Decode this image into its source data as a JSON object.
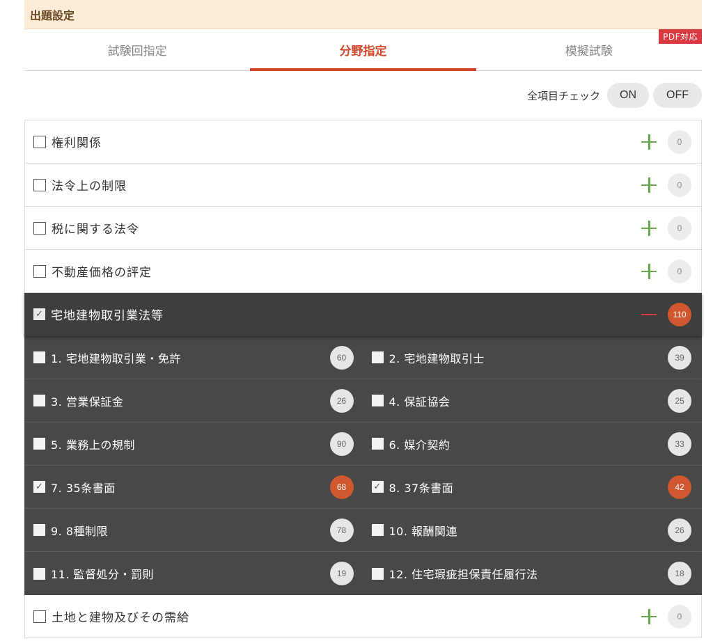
{
  "header": {
    "title": "出題設定"
  },
  "tabs": [
    {
      "label": "試験回指定",
      "active": false
    },
    {
      "label": "分野指定",
      "active": true
    },
    {
      "label": "模擬試験",
      "active": false
    }
  ],
  "pdf_badge": "PDF対応",
  "check_all": {
    "label": "全項目チェック",
    "on": "ON",
    "off": "OFF"
  },
  "categories_top": [
    {
      "name": "権利関係",
      "count": "0"
    },
    {
      "name": "法令上の制限",
      "count": "0"
    },
    {
      "name": "税に関する法令",
      "count": "0"
    },
    {
      "name": "不動産価格の評定",
      "count": "0"
    }
  ],
  "expanded": {
    "name": "宅地建物取引業法等",
    "count": "110",
    "checked": true,
    "items": [
      {
        "label": "1. 宅地建物取引業・免許",
        "count": "60",
        "checked": false
      },
      {
        "label": "2. 宅地建物取引士",
        "count": "39",
        "checked": false
      },
      {
        "label": "3. 営業保証金",
        "count": "26",
        "checked": false
      },
      {
        "label": "4. 保証協会",
        "count": "25",
        "checked": false
      },
      {
        "label": "5. 業務上の規制",
        "count": "90",
        "checked": false
      },
      {
        "label": "6. 媒介契約",
        "count": "33",
        "checked": false
      },
      {
        "label": "7. 35条書面",
        "count": "68",
        "checked": true
      },
      {
        "label": "8. 37条書面",
        "count": "42",
        "checked": true
      },
      {
        "label": "9. 8種制限",
        "count": "78",
        "checked": false
      },
      {
        "label": "10. 報酬関連",
        "count": "26",
        "checked": false
      },
      {
        "label": "11. 監督処分・罰則",
        "count": "19",
        "checked": false
      },
      {
        "label": "12. 住宅瑕疵担保責任履行法",
        "count": "18",
        "checked": false
      }
    ]
  },
  "categories_bottom": [
    {
      "name": "土地と建物及びその需給",
      "count": "0"
    }
  ],
  "colors": {
    "accent": "#d0482a",
    "plus": "#6aa84f",
    "minus": "#d9393f",
    "header_bg": "#fcebd7"
  }
}
